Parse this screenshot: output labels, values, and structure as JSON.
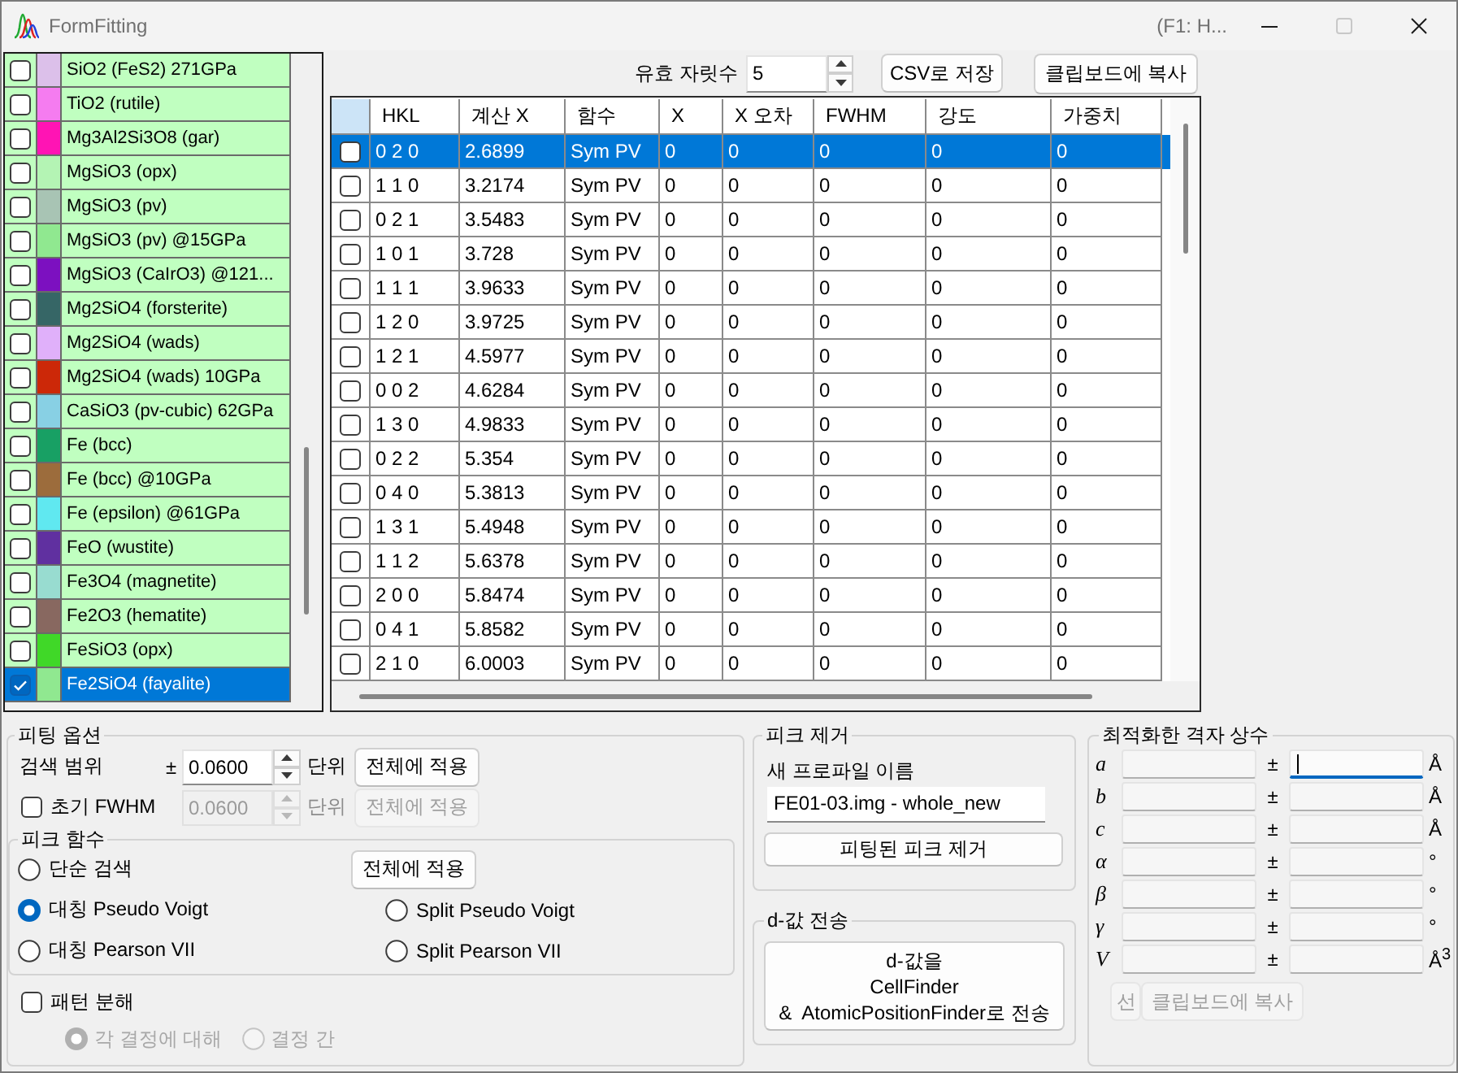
{
  "window": {
    "title": "FormFitting",
    "help_hint": "(F1: H...",
    "controls": [
      {
        "kind": "minimize",
        "disabled": false
      },
      {
        "kind": "maximize",
        "disabled": true
      },
      {
        "kind": "close",
        "disabled": false
      }
    ]
  },
  "phases": [
    {
      "name": "SiO2 (FeS2) 271GPa",
      "color": "#dcc0ea",
      "checked": false,
      "selected": false
    },
    {
      "name": "TiO2 (rutile)",
      "color": "#f57cf0",
      "checked": false,
      "selected": false
    },
    {
      "name": "Mg3Al2Si3O8 (gar)",
      "color": "#ff14b4",
      "checked": false,
      "selected": false
    },
    {
      "name": "MgSiO3 (opx)",
      "color": "#b4f4b4",
      "checked": false,
      "selected": false
    },
    {
      "name": "MgSiO3 (pv)",
      "color": "#a8c4b4",
      "checked": false,
      "selected": false
    },
    {
      "name": "MgSiO3 (pv) @15GPa",
      "color": "#90e890",
      "checked": false,
      "selected": false
    },
    {
      "name": "MgSiO3 (CaIrO3) @121...",
      "color": "#7c10c0",
      "checked": false,
      "selected": false
    },
    {
      "name": "Mg2SiO4 (forsterite)",
      "color": "#366666",
      "checked": false,
      "selected": false
    },
    {
      "name": "Mg2SiO4 (wads)",
      "color": "#e0b0fa",
      "checked": false,
      "selected": false
    },
    {
      "name": "Mg2SiO4 (wads) 10GPa",
      "color": "#cc2808",
      "checked": false,
      "selected": false
    },
    {
      "name": "CaSiO3 (pv-cubic) 62GPa",
      "color": "#88d0e4",
      "checked": false,
      "selected": false
    },
    {
      "name": "Fe (bcc)",
      "color": "#18a064",
      "checked": false,
      "selected": false
    },
    {
      "name": "Fe (bcc) @10GPa",
      "color": "#9c6c3c",
      "checked": false,
      "selected": false
    },
    {
      "name": "Fe (epsilon) @61GPa",
      "color": "#60e8f0",
      "checked": false,
      "selected": false
    },
    {
      "name": "FeO (wustite)",
      "color": "#6030a0",
      "checked": false,
      "selected": false
    },
    {
      "name": "Fe3O4 (magnetite)",
      "color": "#98dcd0",
      "checked": false,
      "selected": false
    },
    {
      "name": "Fe2O3 (hematite)",
      "color": "#886860",
      "checked": false,
      "selected": false
    },
    {
      "name": "FeSiO3 (opx)",
      "color": "#40d828",
      "checked": false,
      "selected": false
    },
    {
      "name": "Fe2SiO4 (fayalite)",
      "color": "#90e890",
      "checked": true,
      "selected": true
    }
  ],
  "precision": {
    "label": "유효 자릿수",
    "value": "5"
  },
  "table_buttons": [
    "CSV로 저장",
    "클립보드에 복사"
  ],
  "peak_table": {
    "columns": [
      "HKL",
      "계산 X",
      "함수",
      "X",
      "X 오차",
      "FWHM",
      "강도",
      "가중치"
    ],
    "rows": [
      {
        "checked": false,
        "selected": true,
        "cells": [
          "0 2 0",
          "2.6899",
          "Sym PV",
          "0",
          "0",
          "0",
          "0",
          "0"
        ]
      },
      {
        "checked": false,
        "selected": false,
        "cells": [
          "1 1 0",
          "3.2174",
          "Sym PV",
          "0",
          "0",
          "0",
          "0",
          "0"
        ]
      },
      {
        "checked": false,
        "selected": false,
        "cells": [
          "0 2 1",
          "3.5483",
          "Sym PV",
          "0",
          "0",
          "0",
          "0",
          "0"
        ]
      },
      {
        "checked": false,
        "selected": false,
        "cells": [
          "1 0 1",
          "3.728",
          "Sym PV",
          "0",
          "0",
          "0",
          "0",
          "0"
        ]
      },
      {
        "checked": false,
        "selected": false,
        "cells": [
          "1 1 1",
          "3.9633",
          "Sym PV",
          "0",
          "0",
          "0",
          "0",
          "0"
        ]
      },
      {
        "checked": false,
        "selected": false,
        "cells": [
          "1 2 0",
          "3.9725",
          "Sym PV",
          "0",
          "0",
          "0",
          "0",
          "0"
        ]
      },
      {
        "checked": false,
        "selected": false,
        "cells": [
          "1 2 1",
          "4.5977",
          "Sym PV",
          "0",
          "0",
          "0",
          "0",
          "0"
        ]
      },
      {
        "checked": false,
        "selected": false,
        "cells": [
          "0 0 2",
          "4.6284",
          "Sym PV",
          "0",
          "0",
          "0",
          "0",
          "0"
        ]
      },
      {
        "checked": false,
        "selected": false,
        "cells": [
          "1 3 0",
          "4.9833",
          "Sym PV",
          "0",
          "0",
          "0",
          "0",
          "0"
        ]
      },
      {
        "checked": false,
        "selected": false,
        "cells": [
          "0 2 2",
          "5.354",
          "Sym PV",
          "0",
          "0",
          "0",
          "0",
          "0"
        ]
      },
      {
        "checked": false,
        "selected": false,
        "cells": [
          "0 4 0",
          "5.3813",
          "Sym PV",
          "0",
          "0",
          "0",
          "0",
          "0"
        ]
      },
      {
        "checked": false,
        "selected": false,
        "cells": [
          "1 3 1",
          "5.4948",
          "Sym PV",
          "0",
          "0",
          "0",
          "0",
          "0"
        ]
      },
      {
        "checked": false,
        "selected": false,
        "cells": [
          "1 1 2",
          "5.6378",
          "Sym PV",
          "0",
          "0",
          "0",
          "0",
          "0"
        ]
      },
      {
        "checked": false,
        "selected": false,
        "cells": [
          "2 0 0",
          "5.8474",
          "Sym PV",
          "0",
          "0",
          "0",
          "0",
          "0"
        ]
      },
      {
        "checked": false,
        "selected": false,
        "cells": [
          "0 4 1",
          "5.8582",
          "Sym PV",
          "0",
          "0",
          "0",
          "0",
          "0"
        ]
      },
      {
        "checked": false,
        "selected": false,
        "cells": [
          "2 1 0",
          "6.0003",
          "Sym PV",
          "0",
          "0",
          "0",
          "0",
          "0"
        ]
      }
    ]
  },
  "fitting_options": {
    "title": "피팅 옵션",
    "search_range": {
      "label": "검색 범위",
      "sign": "±",
      "value": "0.0600",
      "unit": "단위",
      "button": "전체에 적용"
    },
    "initial_fwhm": {
      "label": "초기 FWHM",
      "checked": false,
      "disabled": true,
      "value": "0.0600",
      "unit": "단위",
      "button": "전체에 적용"
    },
    "peak_function": {
      "title": "피크 함수",
      "button": "전체에 적용",
      "options": [
        {
          "label": "단순 검색",
          "selected": false
        },
        {
          "label": "대칭 Pseudo Voigt",
          "selected": true
        },
        {
          "label": "Split Pseudo Voigt",
          "selected": false
        },
        {
          "label": "대칭 Pearson VII",
          "selected": false
        },
        {
          "label": "Split Pearson VII",
          "selected": false
        }
      ]
    },
    "pattern_decomposition": {
      "label": "패턴 분해",
      "checked": false,
      "modes": [
        {
          "label": "각 결정에 대해",
          "selected": true,
          "disabled": true
        },
        {
          "label": "결정 간",
          "selected": false,
          "disabled": true
        }
      ]
    }
  },
  "peak_removal": {
    "title": "피크 제거",
    "field_label": "새 프로파일 이름",
    "value": "FE01-03.img - whole_new",
    "button": "피팅된 피크 제거"
  },
  "d_transfer": {
    "title": "d-값 전송",
    "button": "d-값을\nCellFinder\n&  AtomicPositionFinder로 전송"
  },
  "lattice": {
    "title": "최적화한 격자 상수",
    "rows": [
      {
        "symbol": "a",
        "sign": "±",
        "unit": "Å",
        "error_field_focused": true
      },
      {
        "symbol": "b",
        "sign": "±",
        "unit": "Å",
        "error_field_focused": false
      },
      {
        "symbol": "c",
        "sign": "±",
        "unit": "Å",
        "error_field_focused": false
      },
      {
        "symbol": "α",
        "sign": "±",
        "unit": "°",
        "error_field_focused": false
      },
      {
        "symbol": "β",
        "sign": "±",
        "unit": "°",
        "error_field_focused": false
      },
      {
        "symbol": "γ",
        "sign": "±",
        "unit": "°",
        "error_field_focused": false
      },
      {
        "symbol": "V",
        "sign": "±",
        "unit": "Å$^{3}$",
        "error_field_focused": false
      }
    ],
    "buttons": [
      {
        "label": "선",
        "disabled": true
      },
      {
        "label": "클립보드에 복사",
        "disabled": true
      }
    ]
  }
}
